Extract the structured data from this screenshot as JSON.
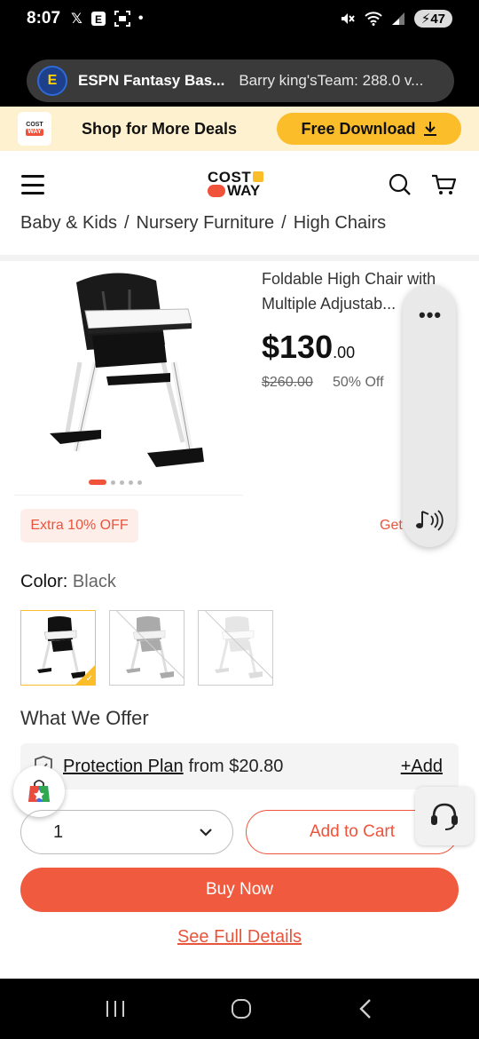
{
  "status": {
    "time": "8:07",
    "left_icons": [
      "x-icon",
      "news-icon",
      "screenshot-icon",
      "dot-icon"
    ],
    "battery": "47"
  },
  "notification": {
    "app_badge": "E",
    "title": "ESPN Fantasy Bas...",
    "text": "Barry king'sTeam: 288.0 v..."
  },
  "promo": {
    "logo_top": "COST",
    "logo_bottom": "WAY",
    "text": "Shop for More Deals",
    "button": "Free Download"
  },
  "header": {
    "logo_top": "COST",
    "logo_bottom": "WAY"
  },
  "breadcrumb": [
    "Baby & Kids",
    "Nursery Furniture",
    "High Chairs"
  ],
  "product": {
    "title": "Foldable High Chair with Multiple Adjustab...",
    "price_main": "$130",
    "price_cents": ".00",
    "old_price": "$260.00",
    "discount": "50% Off",
    "image_count": 5,
    "active_image": 1
  },
  "floating_panel": {
    "menu": "•••"
  },
  "extra": {
    "badge": "Extra 10% OFF",
    "link": "Get"
  },
  "color": {
    "label": "Color:",
    "value": "Black",
    "swatches": [
      "Black",
      "Gray",
      "White"
    ],
    "selected": 0
  },
  "offer": {
    "title": "What We Offer",
    "plan_link": "Protection Plan",
    "plan_price": "from $20.80",
    "add": "+Add"
  },
  "cart": {
    "quantity": "1",
    "add_to_cart": "Add to Cart",
    "buy_now": "Buy Now",
    "full_details": "See Full Details"
  },
  "colors": {
    "accent": "#f0533a",
    "yellow": "#fbbd29",
    "promo_bg": "#fdf1cf"
  }
}
